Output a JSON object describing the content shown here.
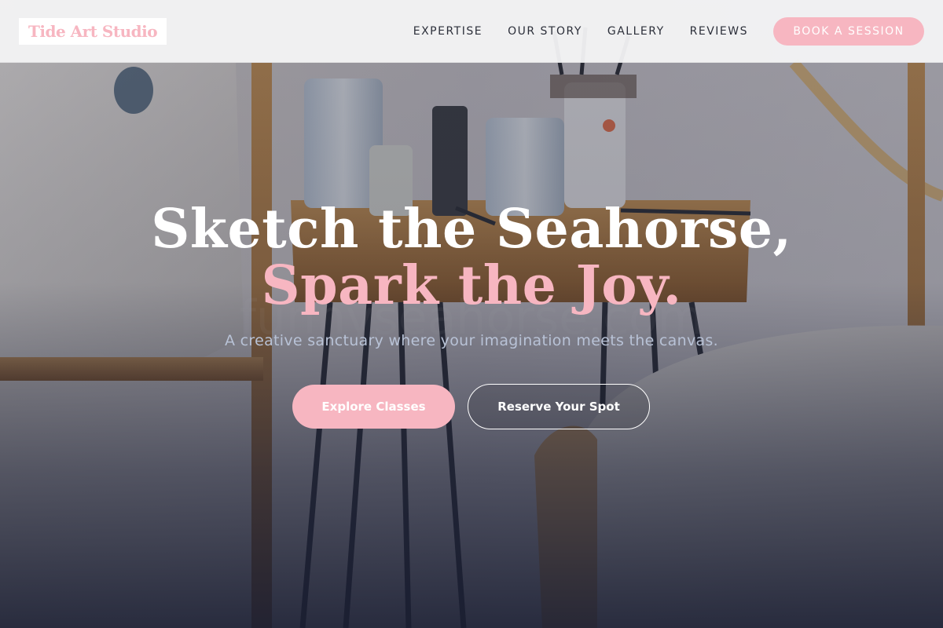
{
  "header": {
    "logo_text": "Tide Art Studio",
    "nav": [
      {
        "label": "EXPERTISE"
      },
      {
        "label": "OUR STORY"
      },
      {
        "label": "GALLERY"
      },
      {
        "label": "REVIEWS"
      }
    ],
    "cta_label": "BOOK A SESSION"
  },
  "hero": {
    "headline_line1": "Sketch the Seahorse,",
    "headline_line2": "Spark the Joy.",
    "subtitle": "A creative sanctuary where your imagination meets the canvas.",
    "primary_button": "Explore Classes",
    "secondary_button": "Reserve Your Spot",
    "background_image_description": "art-studio-table-with-paint-jars-and-brushes"
  },
  "colors": {
    "accent_pink": "#f7b6c1",
    "text_dark": "#2c2f3a",
    "overlay_navy": "#1c2133"
  }
}
